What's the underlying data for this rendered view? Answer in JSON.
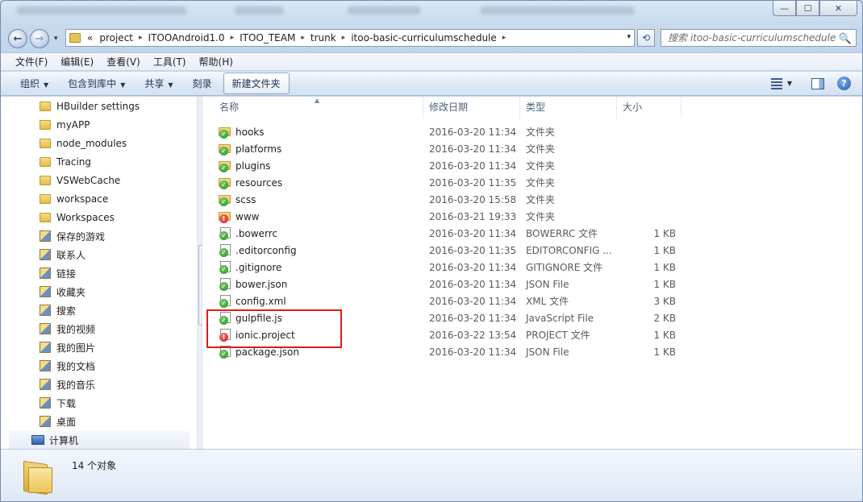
{
  "titlebar": {
    "minimize": "—",
    "maximize": "☐",
    "close": "✕"
  },
  "nav": {
    "back_glyph": "←",
    "forward_glyph": "→",
    "dropdown_glyph": "▾",
    "overflow": "«",
    "breadcrumbs": [
      "project",
      "ITOOAndroid1.0",
      "ITOO_TEAM",
      "trunk",
      "itoo-basic-curriculumschedule"
    ],
    "refresh_glyph": "⟲",
    "search_placeholder": "搜索 itoo-basic-curriculumschedule",
    "search_icon": "🔍"
  },
  "menu": [
    "文件(F)",
    "编辑(E)",
    "查看(V)",
    "工具(T)",
    "帮助(H)"
  ],
  "commands": {
    "organize": "组织",
    "include_library": "包含到库中",
    "share": "共享",
    "burn": "刻录",
    "new_folder": "新建文件夹",
    "help_glyph": "?"
  },
  "navpane": {
    "items": [
      {
        "label": "HBuilder settings",
        "icon": "folder-icon"
      },
      {
        "label": "myAPP",
        "icon": "folder-icon"
      },
      {
        "label": "node_modules",
        "icon": "folder-icon"
      },
      {
        "label": "Tracing",
        "icon": "folder-icon"
      },
      {
        "label": "VSWebCache",
        "icon": "folder-icon"
      },
      {
        "label": "workspace",
        "icon": "folder-icon"
      },
      {
        "label": "Workspaces",
        "icon": "folder-icon"
      },
      {
        "label": "保存的游戏",
        "icon": "saved-games-icon"
      },
      {
        "label": "联系人",
        "icon": "contacts-icon"
      },
      {
        "label": "链接",
        "icon": "links-icon"
      },
      {
        "label": "收藏夹",
        "icon": "favorites-icon"
      },
      {
        "label": "搜索",
        "icon": "searches-icon"
      },
      {
        "label": "我的视频",
        "icon": "videos-icon"
      },
      {
        "label": "我的图片",
        "icon": "pictures-icon"
      },
      {
        "label": "我的文档",
        "icon": "documents-icon"
      },
      {
        "label": "我的音乐",
        "icon": "music-icon"
      },
      {
        "label": "下载",
        "icon": "downloads-icon"
      },
      {
        "label": "桌面",
        "icon": "desktop-icon"
      }
    ],
    "computer": "计算机"
  },
  "filelist": {
    "headers": {
      "name": "名称",
      "date": "修改日期",
      "type": "类型",
      "size": "大小"
    },
    "rows": [
      {
        "name": "hooks",
        "date": "2016-03-20 11:34",
        "type": "文件夹",
        "size": "",
        "kind": "folder",
        "status": "ok"
      },
      {
        "name": "platforms",
        "date": "2016-03-20 11:34",
        "type": "文件夹",
        "size": "",
        "kind": "folder",
        "status": "ok"
      },
      {
        "name": "plugins",
        "date": "2016-03-20 11:34",
        "type": "文件夹",
        "size": "",
        "kind": "folder",
        "status": "ok"
      },
      {
        "name": "resources",
        "date": "2016-03-20 11:35",
        "type": "文件夹",
        "size": "",
        "kind": "folder",
        "status": "ok"
      },
      {
        "name": "scss",
        "date": "2016-03-20 15:58",
        "type": "文件夹",
        "size": "",
        "kind": "folder",
        "status": "ok"
      },
      {
        "name": "www",
        "date": "2016-03-21 19:33",
        "type": "文件夹",
        "size": "",
        "kind": "folder",
        "status": "err"
      },
      {
        "name": ".bowerrc",
        "date": "2016-03-20 11:34",
        "type": "BOWERRC 文件",
        "size": "1 KB",
        "kind": "doc",
        "status": "ok"
      },
      {
        "name": ".editorconfig",
        "date": "2016-03-20 11:35",
        "type": "EDITORCONFIG ...",
        "size": "1 KB",
        "kind": "doc",
        "status": "ok"
      },
      {
        "name": ".gitignore",
        "date": "2016-03-20 11:34",
        "type": "GITIGNORE 文件",
        "size": "1 KB",
        "kind": "doc",
        "status": "ok"
      },
      {
        "name": "bower.json",
        "date": "2016-03-20 11:34",
        "type": "JSON File",
        "size": "1 KB",
        "kind": "doc",
        "status": "ok"
      },
      {
        "name": "config.xml",
        "date": "2016-03-20 11:34",
        "type": "XML 文件",
        "size": "3 KB",
        "kind": "doc",
        "status": "ok"
      },
      {
        "name": "gulpfile.js",
        "date": "2016-03-20 11:34",
        "type": "JavaScript File",
        "size": "2 KB",
        "kind": "doc",
        "status": "ok"
      },
      {
        "name": "ionic.project",
        "date": "2016-03-22 13:54",
        "type": "PROJECT 文件",
        "size": "1 KB",
        "kind": "doc",
        "status": "err"
      },
      {
        "name": "package.json",
        "date": "2016-03-20 11:34",
        "type": "JSON File",
        "size": "1 KB",
        "kind": "doc",
        "status": "ok"
      }
    ]
  },
  "details": {
    "count": "14 个对象"
  },
  "colors": {
    "highlight": "#e01a1a",
    "ok_badge": "#1b8a1b",
    "err_badge": "#c01515"
  }
}
